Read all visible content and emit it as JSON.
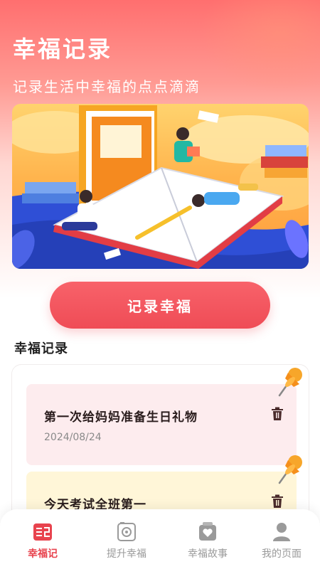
{
  "header": {
    "title": "幸福记录",
    "subtitle": "记录生活中幸福的点点滴滴"
  },
  "cta": {
    "label": "记录幸福"
  },
  "section": {
    "title": "幸福记录"
  },
  "records": [
    {
      "title": "第一次给妈妈准备生日礼物",
      "date": "2024/08/24",
      "color": "#fdecee"
    },
    {
      "title": "今天考试全班第一",
      "date": "",
      "color": "#fff6d8"
    }
  ],
  "tabbar": {
    "tabs": [
      {
        "label": "幸福记",
        "icon": "record-icon",
        "active": true
      },
      {
        "label": "提升幸福",
        "icon": "camera-icon",
        "active": false
      },
      {
        "label": "幸福故事",
        "icon": "heart-box-icon",
        "active": false
      },
      {
        "label": "我的页面",
        "icon": "user-icon",
        "active": false
      }
    ],
    "active_color": "#e8434e",
    "inactive_color": "#9a9a9a"
  },
  "colors": {
    "accent": "#ef4c56",
    "header_gradient_top": "#ff6f6f"
  }
}
